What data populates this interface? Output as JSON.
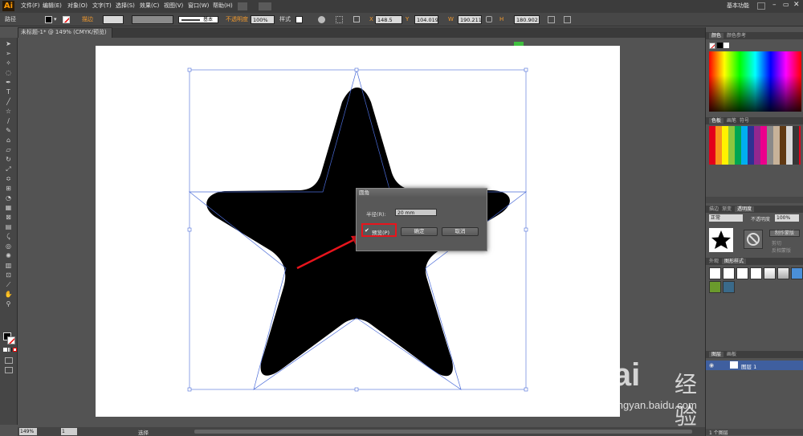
{
  "app": {
    "logo": "Ai"
  },
  "menu": [
    "文件(F)",
    "编辑(E)",
    "对象(O)",
    "文字(T)",
    "选择(S)",
    "效果(C)",
    "视图(V)",
    "窗口(W)",
    "帮助(H)"
  ],
  "workspace": "基本功能",
  "control": {
    "selection_label": "路径",
    "stroke_label": "描边",
    "stroke_style": "基本",
    "opacity_label": "不透明度",
    "opacity": "100%",
    "style_label": "样式",
    "x": "148.5 mm",
    "y": "104.019",
    "w": "190.211",
    "h": "180.902"
  },
  "document": {
    "tab": "未标题-1* @ 149% (CMYK/预览)"
  },
  "status": {
    "zoom": "149%",
    "page": "1",
    "mode": "选择"
  },
  "dialog": {
    "title": "圆角",
    "radius_label": "半径(R):",
    "radius_value": "20 mm",
    "preview_label": "预览(P)",
    "preview_checked": true,
    "ok": "确定",
    "cancel": "取消"
  },
  "panels": {
    "color": {
      "tabs": [
        "颜色",
        "颜色参考"
      ]
    },
    "swatches": {
      "tabs": [
        "色板",
        "画笔",
        "符号"
      ]
    },
    "transparency": {
      "tabs": [
        "描边",
        "渐变",
        "透明度"
      ],
      "blend": "正常",
      "opacity_label": "不透明度",
      "opacity": "100%",
      "make_mask": "制作蒙版",
      "clip": "剪切",
      "invert": "反相蒙版"
    },
    "appearance": {
      "tabs": [
        "外观",
        "图形样式"
      ]
    },
    "layers": {
      "tabs": [
        "图层",
        "画板"
      ],
      "layer_name": "图层 1",
      "count": "1 个图层"
    }
  },
  "watermark": {
    "brand": "Bai",
    "brand2": "经验",
    "url": "jingyan.baidu.com"
  },
  "colors": {
    "accent": "#f29a2e",
    "highlight_box": "#e8141c",
    "arrow": "#e8141c",
    "selection": "#4a6bd8"
  }
}
